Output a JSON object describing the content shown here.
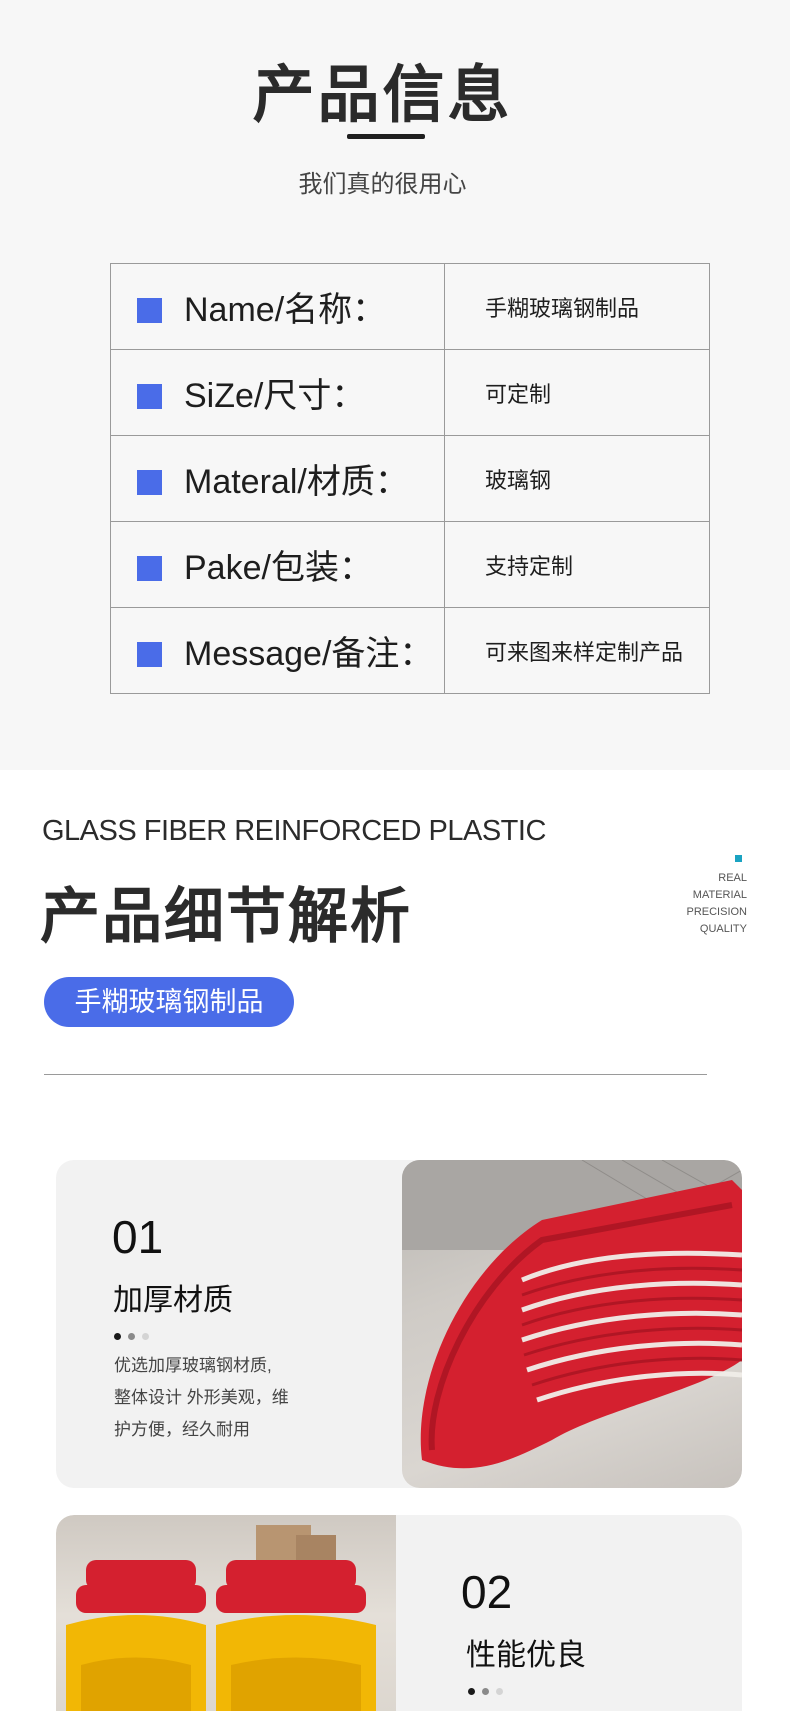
{
  "product_info": {
    "title": "产品信息",
    "subtitle": "我们真的很用心",
    "rows": [
      {
        "key": "Name/名称：",
        "value": "手糊玻璃钢制品"
      },
      {
        "key": "SiZe/尺寸：",
        "value": "可定制"
      },
      {
        "key": "Materal/材质：",
        "value": "玻璃钢"
      },
      {
        "key": "Pake/包装：",
        "value": "支持定制"
      },
      {
        "key": "Message/备注：",
        "value": "可来图来样定制产品"
      }
    ]
  },
  "detail_header": {
    "english_title": "GLASS FIBER REINFORCED PLASTIC",
    "title": "产品细节解析",
    "side_text": [
      "REAL",
      "MATERIAL",
      "PRECISION",
      "QUALITY"
    ],
    "pill_label": "手糊玻璃钢制品"
  },
  "features": [
    {
      "number": "01",
      "heading": "加厚材质",
      "description": [
        "优选加厚玻璃钢材质,",
        "整体设计 外形美观，维",
        "护方便，经久耐用"
      ]
    },
    {
      "number": "02",
      "heading": "性能优良"
    }
  ],
  "colors": {
    "accent": "#4a6ce8",
    "product_red": "#d4202f",
    "product_yellow": "#f2b705"
  }
}
